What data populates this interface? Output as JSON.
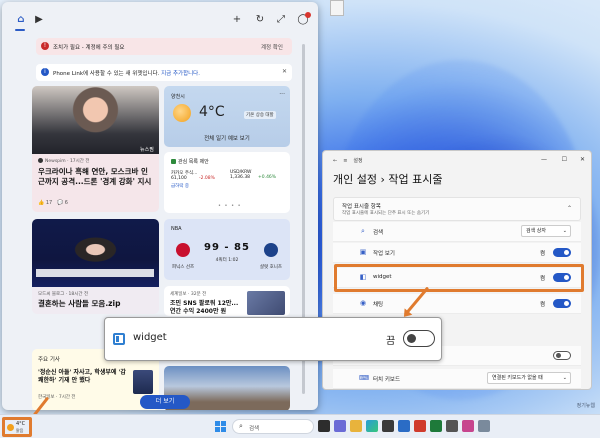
{
  "widgets": {
    "alert1": {
      "text": "조치가 필요 - 계정에 주의 필요",
      "action": "계정 확인"
    },
    "alert2": {
      "text": "Phone Link에 사용할 수 있는 새 위젯입니다.",
      "link": "지금 추가합니다."
    },
    "news1": {
      "badge": "뉴스핌",
      "source": "Newspim · 17시간 전",
      "headline": "우크라이나 흑해 연안, 모스크바 인근까지 공격...드론 '경계 강화' 지시",
      "likes": "17",
      "comments": "6"
    },
    "weather": {
      "location": "양천시",
      "temp": "4°C",
      "warning": "기온 상승 대할",
      "forecast": "전체 일기 예보 보기"
    },
    "stocks": {
      "title": "관심 목록 제안",
      "items": [
        {
          "name": "카카오 주식...",
          "value": "61,100",
          "change": "-2.08%",
          "dir": "down",
          "tag": "급하락 중"
        },
        {
          "name": "USD/KRW",
          "value": "1,336.38",
          "change": "+0.46%",
          "dir": "up",
          "tag": ""
        }
      ]
    },
    "nba": {
      "league": "NBA",
      "score": "99 - 85",
      "quarter": "4쿼터 1:02",
      "team1": "피닉스 선즈",
      "team2": "샬럿 호니츠"
    },
    "news2": {
      "source": "모드씨 블로그 · 18시간 전",
      "headline": "결혼하는 사람들 모음.zip"
    },
    "news3": {
      "source": "세계일보 · 32분 전",
      "headline": "조민 SNS 팔로워 12만... 연간 수익 2400만 원"
    },
    "topnews": {
      "header": "주요 기사",
      "item": "'정순신 아들' 자사고, 학생부에 '감쾌한하' 기재 안 했다",
      "source": "한국일보 · 7시간 전"
    },
    "more_label": "더 보기"
  },
  "settings": {
    "app_title": "설정",
    "breadcrumb_parent": "개인 설정",
    "breadcrumb_sep": "›",
    "breadcrumb_current": "작업 표시줄",
    "section_title": "작업 표시줄 항목",
    "section_sub": "작업 표시줄에 표시되는 단추 표시 또는 숨기기",
    "rows": [
      {
        "label": "검색",
        "state": "검색 상자"
      },
      {
        "label": "작업 보기",
        "state": "켬"
      },
      {
        "label": "widget",
        "state": "켬"
      },
      {
        "label": "채팅",
        "state": "켬"
      }
    ],
    "touch_label": "터치 키보드",
    "touch_state": "연결된 키보드가 없을 때",
    "partial": "표시"
  },
  "callout": {
    "label": "widget",
    "state": "끔"
  },
  "taskbar": {
    "weather_temp": "4°C",
    "weather_status": "맑음",
    "search_placeholder": "검색"
  },
  "watermark": "정기뉴웹"
}
